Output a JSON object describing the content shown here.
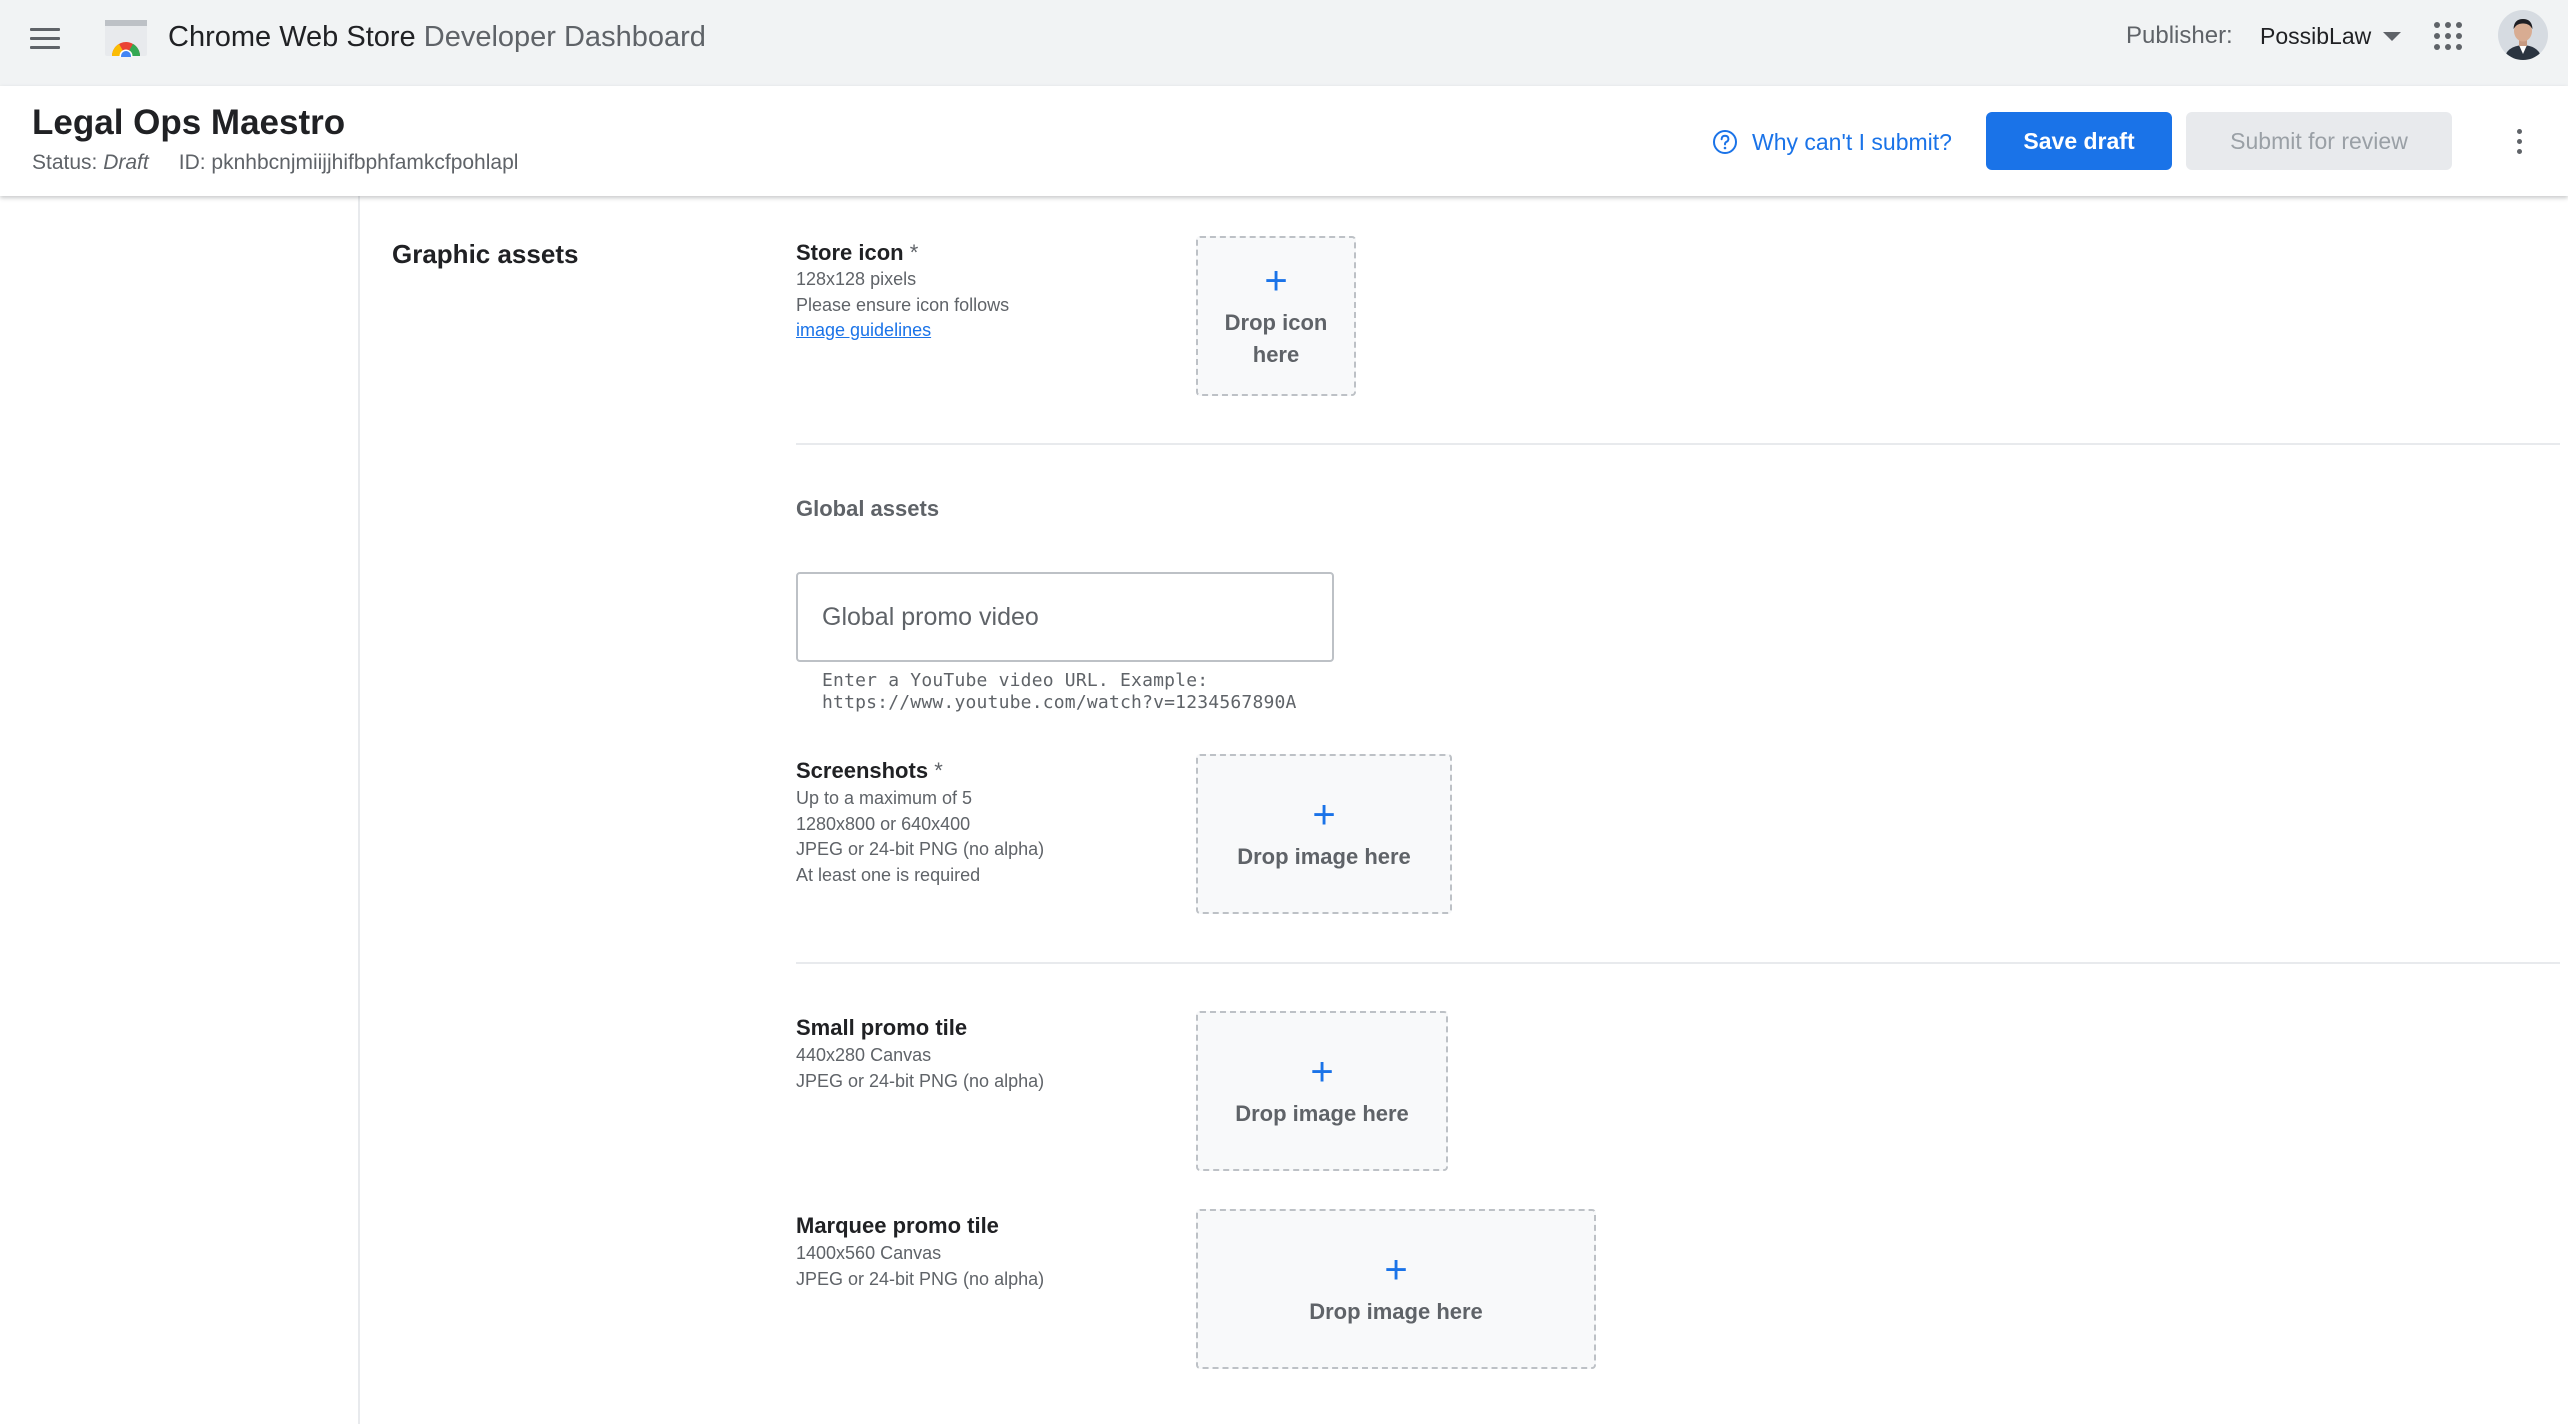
{
  "app": {
    "title_bold": "Chrome Web Store",
    "title_light": "Developer Dashboard",
    "publisher_label": "Publisher:",
    "publisher_name": "PossibLaw"
  },
  "item": {
    "name": "Legal Ops Maestro",
    "status_label": "Status:",
    "status_value": "Draft",
    "id_label": "ID:",
    "id_value": "pknhbcnjmiijjhifbphfamkcfpohlapl",
    "why_link": "Why can't I submit?",
    "save_label": "Save draft",
    "submit_label": "Submit for review"
  },
  "section": {
    "title": "Graphic assets"
  },
  "store_icon": {
    "label": "Store icon",
    "required_mark": "*",
    "desc_1": "128x128 pixels",
    "desc_2": "Please ensure icon follows",
    "guidelines_link": "image guidelines",
    "drop_line_1": "Drop icon",
    "drop_line_2": "here"
  },
  "global_assets": {
    "title": "Global assets",
    "video_placeholder": "Global promo video",
    "video_hint_1": "Enter a YouTube video URL. Example:",
    "video_hint_2": "https://www.youtube.com/watch?v=1234567890A"
  },
  "screenshots": {
    "label": "Screenshots",
    "required_mark": "*",
    "desc_1": "Up to a maximum of 5",
    "desc_2": "1280x800 or 640x400",
    "desc_3": "JPEG or 24-bit PNG (no alpha)",
    "desc_4": "At least one is required",
    "drop_text": "Drop image here"
  },
  "small_promo": {
    "label": "Small promo tile",
    "desc_1": "440x280 Canvas",
    "desc_2": "JPEG or 24-bit PNG (no alpha)",
    "drop_text": "Drop image here"
  },
  "marquee_promo": {
    "label": "Marquee promo tile",
    "desc_1": "1400x560 Canvas",
    "desc_2": "JPEG or 24-bit PNG (no alpha)",
    "drop_text": "Drop image here"
  },
  "icons": {
    "plus": "+",
    "menu": "menu-icon",
    "apps": "apps-grid-icon",
    "help": "help-circle-icon",
    "more": "more-vert-icon"
  },
  "colors": {
    "accent": "#1a73e8",
    "appbar_bg": "#f1f3f4",
    "disabled_bg": "#e8eaed",
    "disabled_text": "#9aa0a6"
  }
}
